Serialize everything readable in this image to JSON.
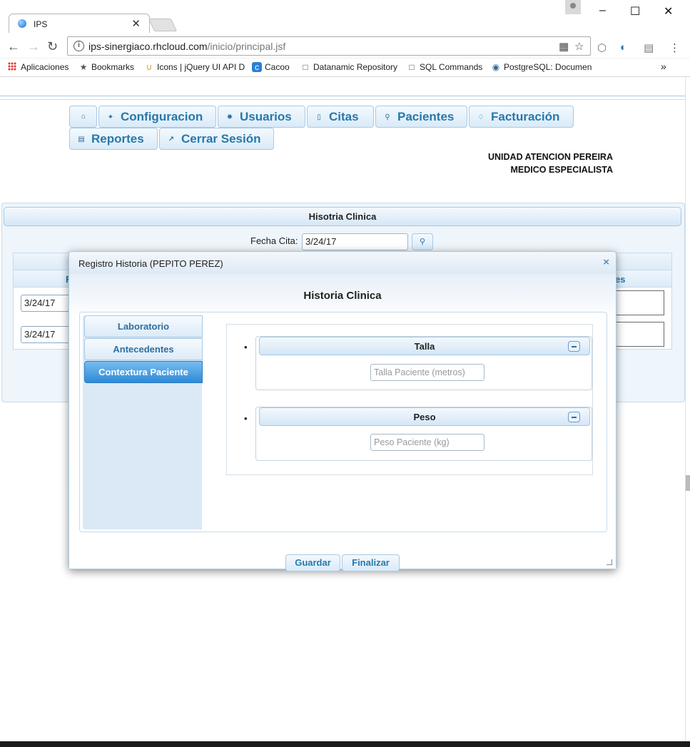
{
  "browser": {
    "tab_title": "IPS",
    "tab_close": "✕",
    "url_host": "ips-sinergiaco.rhcloud.com",
    "url_path": "/inicio/principal.jsf",
    "bookmarks": [
      {
        "label": "Aplicaciones",
        "icon": "apps-grid-icon"
      },
      {
        "label": "Bookmarks",
        "icon": "star-icon"
      },
      {
        "label": "Icons | jQuery UI API D",
        "icon": "jquery-icon"
      },
      {
        "label": "Cacoo",
        "icon": "cacoo-icon"
      },
      {
        "label": "Datanamic Repository",
        "icon": "page-icon"
      },
      {
        "label": "SQL Commands",
        "icon": "page-icon"
      },
      {
        "label": "PostgreSQL: Documen",
        "icon": "postgresql-icon"
      }
    ],
    "more_bookmarks": "»"
  },
  "menu": {
    "home": "",
    "items": [
      {
        "label": "Configuracion",
        "icon": "wrench-icon"
      },
      {
        "label": "Usuarios",
        "icon": "gear-icon"
      },
      {
        "label": "Citas",
        "icon": "clipboard-icon"
      },
      {
        "label": "Pacientes",
        "icon": "person-icon"
      },
      {
        "label": "Facturación",
        "icon": "note-icon"
      },
      {
        "label": "Reportes",
        "icon": "document-icon"
      },
      {
        "label": "Cerrar Sesión",
        "icon": "external-link-icon"
      }
    ]
  },
  "header": {
    "unit": "UNIDAD ATENCION PEREIRA",
    "role": "MEDICO ESPECIALISTA"
  },
  "panel": {
    "title": "Hisotria Clinica",
    "fecha_label": "Fecha Cita:",
    "fecha_value": "3/24/17",
    "table": {
      "col_left_partial": "F",
      "col_right_partial": "es",
      "rows": [
        {
          "fecha": "3/24/17"
        },
        {
          "fecha": "3/24/17"
        }
      ]
    }
  },
  "dialog": {
    "title": "Registro Historia (PEPITO PEREZ)",
    "close": "×",
    "heading": "Historia Clinica",
    "tabs": [
      {
        "label": "Laboratorio",
        "active": false
      },
      {
        "label": "Antecedentes",
        "active": false
      },
      {
        "label": "Contextura Paciente",
        "active": true
      }
    ],
    "fields": [
      {
        "legend": "Talla",
        "placeholder": "Talla Paciente (metros)"
      },
      {
        "legend": "Peso",
        "placeholder": "Peso Paciente (kg)"
      }
    ],
    "buttons": {
      "save": "Guardar",
      "finish": "Finalizar"
    }
  },
  "colors": {
    "accent": "#2779aa",
    "active_tab": "#2d8ad7",
    "header_bg": "#d9eaf8"
  }
}
